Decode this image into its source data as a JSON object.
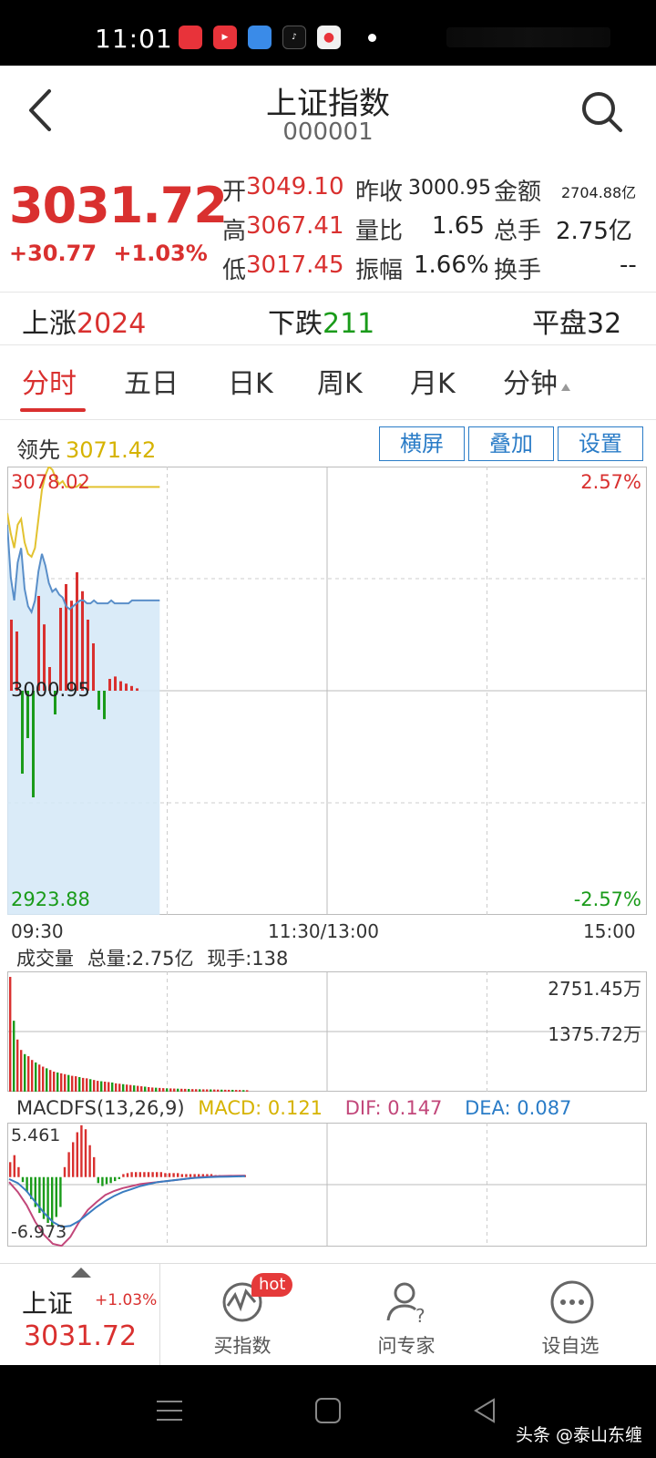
{
  "status": {
    "time": "11:01"
  },
  "header": {
    "title": "上证指数",
    "code": "000001"
  },
  "quote": {
    "price": "3031.72",
    "change": "+30.77",
    "change_pct": "+1.03%",
    "open_label": "开",
    "open": "3049.10",
    "prev_close_label": "昨收",
    "prev_close": "3000.95",
    "amount_label": "金额",
    "amount": "2704.88亿",
    "high_label": "高",
    "high": "3067.41",
    "vol_ratio_label": "量比",
    "vol_ratio": "1.65",
    "total_vol_label": "总手",
    "total_vol": "2.75亿",
    "low_label": "低",
    "low": "3017.45",
    "amplitude_label": "振幅",
    "amplitude": "1.66%",
    "turnover_label": "换手",
    "turnover": "--"
  },
  "breadth": {
    "up_label": "上涨",
    "up": "2024",
    "down_label": "下跌",
    "down": "211",
    "flat_label": "平盘",
    "flat": "32"
  },
  "tabs": [
    "分时",
    "五日",
    "日K",
    "周K",
    "月K",
    "分钟"
  ],
  "chart_head": {
    "lead_label": "领先",
    "lead_value": "3071.42",
    "buttons": [
      "横屏",
      "叠加",
      "设置"
    ]
  },
  "chart_data": [
    {
      "type": "line",
      "name": "intraday",
      "y_top_label": "3078.02",
      "y_mid_label": "3000.95",
      "y_bottom_label": "2923.88",
      "pct_top": "2.57%",
      "pct_bottom": "-2.57%",
      "ylim": [
        2923.88,
        3078.02
      ],
      "time_labels": [
        "09:30",
        "11:30/13:00",
        "15:00"
      ],
      "series": [
        {
          "values": [
            3058,
            3040,
            3032,
            3045,
            3050,
            3036,
            3030,
            3028,
            3032,
            3042,
            3048,
            3044,
            3038,
            3035,
            3036,
            3034,
            3033,
            3030,
            3029,
            3030,
            3031,
            3032,
            3032,
            3031,
            3031,
            3032,
            3031,
            3031,
            3031,
            3031,
            3032,
            3031,
            3031,
            3031,
            3031,
            3031,
            3032,
            3032,
            3032,
            3032,
            3032,
            3032,
            3032,
            3032,
            3032
          ]
        },
        {
          "values": [
            3062,
            3055,
            3050,
            3058,
            3060,
            3052,
            3048,
            3047,
            3050,
            3060,
            3070,
            3075,
            3078,
            3077,
            3074,
            3072,
            3073,
            3071,
            3071,
            3071,
            3071,
            3072,
            3071,
            3071,
            3071,
            3071,
            3071,
            3071,
            3071,
            3071,
            3071,
            3071,
            3071,
            3071,
            3071,
            3071,
            3071,
            3071,
            3071,
            3071,
            3071,
            3071,
            3071,
            3071,
            3071
          ]
        }
      ],
      "bars": [
        30,
        25,
        -35,
        -20,
        -45,
        40,
        28,
        10,
        -10,
        35,
        45,
        38,
        50,
        42,
        30,
        20,
        -8,
        -12,
        5,
        6,
        4,
        3,
        2,
        1
      ]
    },
    {
      "type": "bar",
      "name": "volume",
      "title": "成交量",
      "total_label": "总量:2.75亿",
      "current_label": "现手:138",
      "y_top_label": "2751.45万",
      "y_mid_label": "1375.72万",
      "ylim": [
        0,
        2751.45
      ],
      "values": [
        2751,
        1700,
        1250,
        1000,
        900,
        850,
        760,
        700,
        650,
        600,
        560,
        520,
        480,
        460,
        440,
        420,
        400,
        380,
        370,
        350,
        330,
        320,
        300,
        280,
        260,
        250,
        240,
        230,
        220,
        200,
        190,
        180,
        170,
        160,
        150,
        140,
        130,
        120,
        110,
        100,
        95,
        90,
        85,
        80,
        78,
        75,
        72,
        70,
        68,
        65,
        62,
        60,
        58,
        56,
        55,
        54,
        52,
        50,
        48,
        46,
        45,
        44,
        42,
        40,
        38,
        36
      ]
    },
    {
      "type": "bar",
      "name": "macd",
      "title": "MACDFS(13,26,9)",
      "macd_label": "MACD: 0.121",
      "dif_label": "DIF: 0.147",
      "dea_label": "DEA: 0.087",
      "y_top_label": "5.461",
      "y_bottom_label": "-6.973",
      "ylim": [
        -6.973,
        5.461
      ],
      "values": [
        1.5,
        2.2,
        1.0,
        -0.5,
        -1.5,
        -2.2,
        -3.0,
        -3.6,
        -4.2,
        -4.6,
        -5.0,
        -4.0,
        -3.0,
        1.0,
        2.5,
        3.5,
        4.5,
        5.2,
        4.8,
        3.2,
        2.0,
        -0.6,
        -0.9,
        -0.7,
        -0.6,
        -0.4,
        -0.2,
        0.3,
        0.4,
        0.5,
        0.5,
        0.5,
        0.5,
        0.5,
        0.5,
        0.5,
        0.5,
        0.4,
        0.4,
        0.4,
        0.4,
        0.3,
        0.3,
        0.3,
        0.3,
        0.3,
        0.3,
        0.3,
        0.3,
        0.2,
        0.2,
        0.2,
        0.2,
        0.2,
        0.2,
        0.2,
        0.2
      ],
      "dif": [
        -0.5,
        -1.5,
        -2.8,
        -4.5,
        -5.8,
        -6.7,
        -6.9,
        -6.0,
        -4.5,
        -3.3,
        -2.5,
        -1.8,
        -1.4,
        -1.1,
        -0.9,
        -0.7,
        -0.6,
        -0.5,
        -0.4,
        -0.3,
        -0.2,
        -0.1,
        0.0,
        0.05,
        0.1,
        0.12,
        0.14,
        0.15
      ],
      "dea": [
        -0.2,
        -0.6,
        -1.4,
        -2.5,
        -3.6,
        -4.5,
        -5.0,
        -4.9,
        -4.4,
        -3.7,
        -3.0,
        -2.4,
        -1.9,
        -1.5,
        -1.2,
        -0.9,
        -0.7,
        -0.5,
        -0.4,
        -0.3,
        -0.2,
        -0.1,
        -0.05,
        0.0,
        0.03,
        0.05,
        0.07,
        0.09
      ]
    }
  ],
  "bottom_bar": {
    "index_name": "上证",
    "index_pct": "+1.03%",
    "index_price": "3031.72",
    "items": [
      "买指数",
      "问专家",
      "设自选"
    ],
    "hot_badge": "hot"
  },
  "watermark": "头条 @泰山东缠",
  "colors": {
    "up": "#d9302f",
    "down": "#1a9b1a",
    "price_line": "#5a8fc9",
    "lead_line": "#e2c230",
    "accent": "#2a7cc7"
  }
}
